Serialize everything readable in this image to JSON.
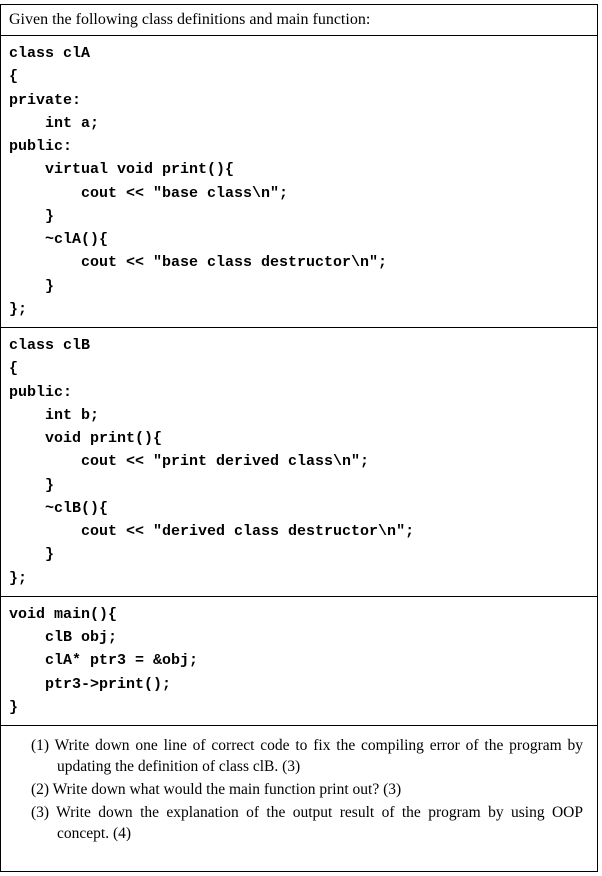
{
  "intro": "Given the following class definitions and main function:",
  "code": {
    "blockA": "class clA\n{\nprivate:\n    int a;\npublic:\n    virtual void print(){\n        cout << \"base class\\n\";\n    }\n    ~clA(){\n        cout << \"base class destructor\\n\";\n    }\n};",
    "blockB": "class clB\n{\npublic:\n    int b;\n    void print(){\n        cout << \"print derived class\\n\";\n    }\n    ~clB(){\n        cout << \"derived class destructor\\n\";\n    }\n};",
    "blockMain": "void main(){\n    clB obj;\n    clA* ptr3 = &obj;\n    ptr3->print();\n}"
  },
  "questions": {
    "q1": "(1) Write down one line of correct code to fix the compiling error of the program by updating the definition of class clB. (3)",
    "q2": "(2) Write down what would the main function print out? (3)",
    "q3": "(3) Write down the explanation of the output result of the program by using OOP concept. (4)"
  }
}
